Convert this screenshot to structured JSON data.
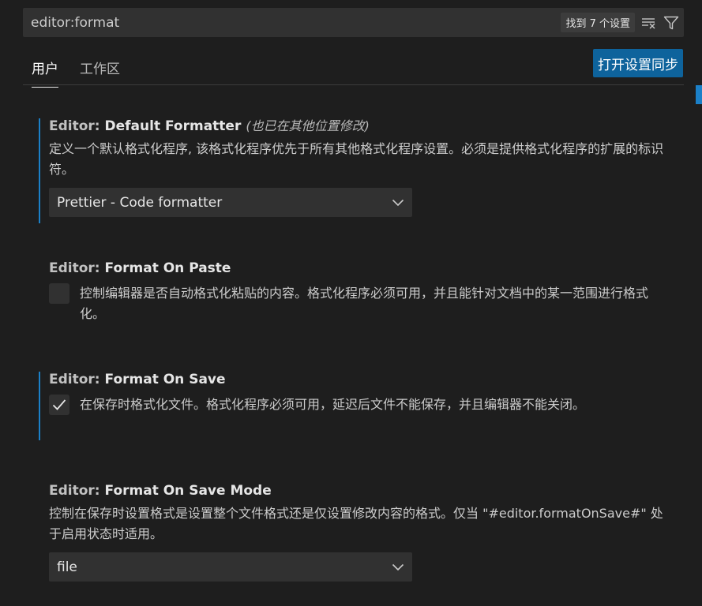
{
  "search": {
    "value": "editor:format",
    "result_count": "找到 7 个设置"
  },
  "tabs": {
    "user": "用户",
    "workspace": "工作区"
  },
  "sync_button": "打开设置同步",
  "settings": [
    {
      "category": "Editor: ",
      "name": "Default Formatter",
      "note": "(也已在其他位置修改)",
      "description": "定义一个默认格式化程序, 该格式化程序优先于所有其他格式化程序设置。必须是提供格式化程序的扩展的标识符。",
      "value": "Prettier - Code formatter"
    },
    {
      "category": "Editor: ",
      "name": "Format On Paste",
      "description": "控制编辑器是否自动格式化粘贴的内容。格式化程序必须可用，并且能针对文档中的某一范围进行格式化。",
      "checked": false
    },
    {
      "category": "Editor: ",
      "name": "Format On Save",
      "description": "在保存时格式化文件。格式化程序必须可用，延迟后文件不能保存，并且编辑器不能关闭。",
      "checked": true
    },
    {
      "category": "Editor: ",
      "name": "Format On Save Mode",
      "description": "控制在保存时设置格式是设置整个文件格式还是仅设置修改内容的格式。仅当 \"#editor.formatOnSave#\" 处于启用状态时适用。",
      "value": "file"
    }
  ],
  "colors": {
    "accent": "#0e639c",
    "modified_indicator": "#1b80c8",
    "background": "#1e1e1e"
  }
}
